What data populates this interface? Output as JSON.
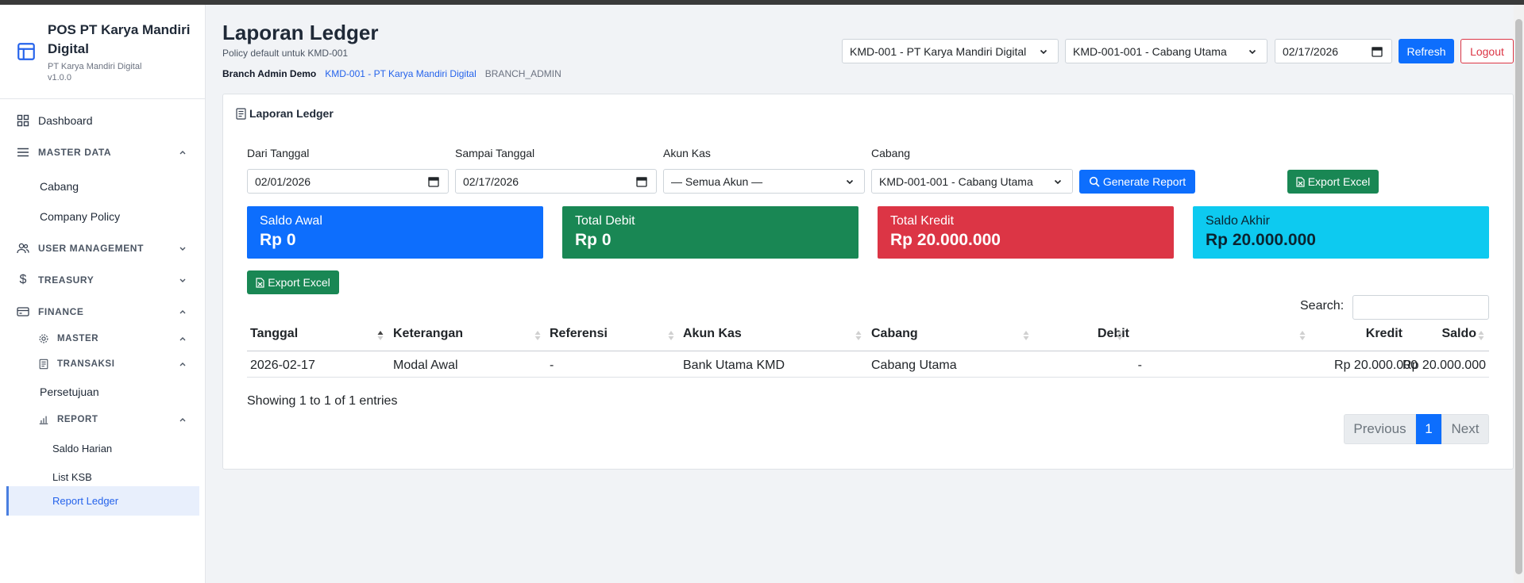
{
  "sidebar": {
    "brand_title": "POS PT Karya Mandiri Digital",
    "brand_subtitle": "PT Karya Mandiri Digital",
    "version": "v1.0.0",
    "items": {
      "dashboard": "Dashboard",
      "master_data": "MASTER DATA",
      "cabang": "Cabang",
      "company_policy": "Company Policy",
      "user_management": "USER MANAGEMENT",
      "treasury": "TREASURY",
      "finance": "FINANCE",
      "master": "MASTER",
      "transaksi": "TRANSAKSI",
      "persetujuan": "Persetujuan",
      "report": "REPORT",
      "saldo_harian": "Saldo Harian",
      "list_ksb": "List KSB",
      "report_ledger": "Report Ledger"
    }
  },
  "header": {
    "title": "Laporan Ledger",
    "subtitle": "Policy default untuk KMD-001",
    "user_name": "Branch Admin Demo",
    "user_company": "KMD-001 - PT Karya Mandiri Digital",
    "user_role": "BRANCH_ADMIN",
    "company_select": "KMD-001 - PT Karya Mandiri Digital",
    "branch_select": "KMD-001-001 - Cabang Utama",
    "date": "02/17/2026",
    "refresh_label": "Refresh",
    "logout_label": "Logout"
  },
  "report": {
    "card_title": "Laporan Ledger",
    "from_label": "Dari Tanggal",
    "from_value": "02/01/2026",
    "to_label": "Sampai Tanggal",
    "to_value": "02/17/2026",
    "account_label": "Akun Kas",
    "account_value": "— Semua Akun —",
    "branch_label": "Cabang",
    "branch_value": "KMD-001-001 - Cabang Utama",
    "generate_label": "Generate Report",
    "export_label": "Export Excel"
  },
  "stats": {
    "saldo_awal_label": "Saldo Awal",
    "saldo_awal_value": "Rp 0",
    "total_debit_label": "Total Debit",
    "total_debit_value": "Rp 0",
    "total_kredit_label": "Total Kredit",
    "total_kredit_value": "Rp 20.000.000",
    "saldo_akhir_label": "Saldo Akhir",
    "saldo_akhir_value": "Rp 20.000.000"
  },
  "table": {
    "export_label": "Export Excel",
    "search_label": "Search:",
    "columns": [
      "Tanggal",
      "Keterangan",
      "Referensi",
      "Akun Kas",
      "Cabang",
      "Debit",
      "Kredit",
      "Saldo"
    ],
    "rows": [
      [
        "2026-02-17",
        "Modal Awal",
        "-",
        "Bank Utama KMD",
        "Cabang Utama",
        "-",
        "Rp 20.000.000",
        "Rp 20.000.000"
      ]
    ],
    "info": "Showing 1 to 1 of 1 entries",
    "pagination": {
      "previous": "Previous",
      "page": "1",
      "next": "Next"
    }
  },
  "colors": {
    "primary": "#0d6efd",
    "success": "#198754",
    "danger": "#dc3545",
    "info": "#0dcaf0"
  }
}
